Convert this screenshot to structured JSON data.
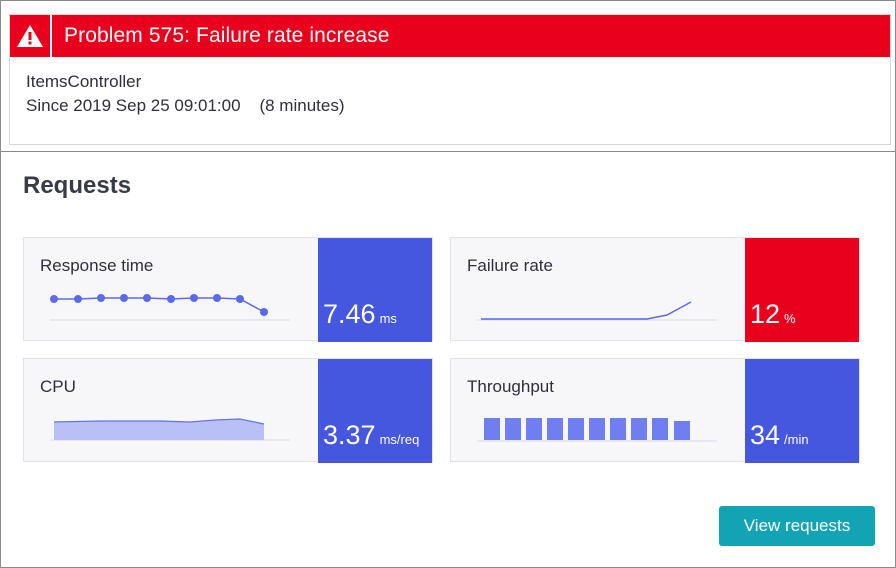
{
  "problem": {
    "title": "Problem 575: Failure rate increase",
    "entity": "ItemsController",
    "since": "Since 2019 Sep 25 09:01:00    (8 minutes)",
    "icon": "warning-triangle-icon",
    "color": "#e8001c"
  },
  "section": {
    "title": "Requests"
  },
  "metrics": [
    {
      "label": "Response time",
      "value": "7.46",
      "unit": "ms",
      "color": "#4556df",
      "chart": "dot-line"
    },
    {
      "label": "Failure rate",
      "value": "12",
      "unit": "%",
      "color": "#e8001c",
      "chart": "line"
    },
    {
      "label": "CPU",
      "value": "3.37",
      "unit": "ms/req",
      "color": "#4556df",
      "chart": "area"
    },
    {
      "label": "Throughput",
      "value": "34",
      "unit": "/min",
      "color": "#4556df",
      "chart": "bars"
    }
  ],
  "actions": {
    "view_requests_label": "View requests",
    "button_color": "#12a4b4"
  }
}
